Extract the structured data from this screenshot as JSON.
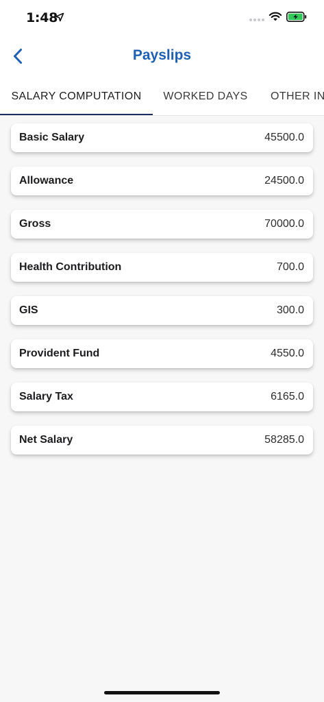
{
  "status_bar": {
    "time": "1:48",
    "icons": [
      "location-arrow-icon",
      "cellular-signal-icon",
      "wifi-icon",
      "battery-charging-icon"
    ]
  },
  "nav": {
    "title": "Payslips",
    "back_icon": "chevron-left-icon",
    "accent_color": "#1f5fb3"
  },
  "tabs": [
    {
      "label": "SALARY COMPUTATION",
      "active": true
    },
    {
      "label": "WORKED DAYS",
      "active": false
    },
    {
      "label": "OTHER INI",
      "active": false
    }
  ],
  "items": [
    {
      "label": "Basic Salary",
      "value": "45500.0"
    },
    {
      "label": "Allowance",
      "value": "24500.0"
    },
    {
      "label": "Gross",
      "value": "70000.0"
    },
    {
      "label": "Health Contribution",
      "value": "700.0"
    },
    {
      "label": "GIS",
      "value": "300.0"
    },
    {
      "label": "Provident Fund",
      "value": "4550.0"
    },
    {
      "label": "Salary Tax",
      "value": "6165.0"
    },
    {
      "label": "Net Salary",
      "value": "58285.0"
    }
  ],
  "colors": {
    "tab_indicator": "#1a2e63",
    "battery_charging": "#34c759",
    "background": "#f7f7f7"
  }
}
